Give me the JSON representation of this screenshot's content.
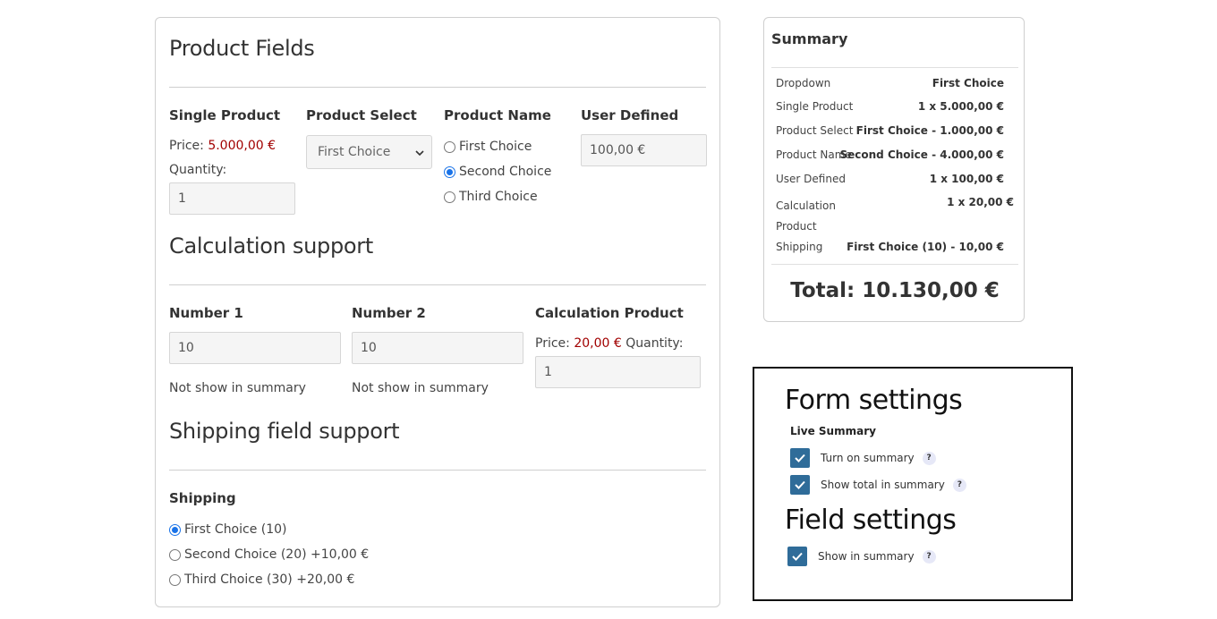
{
  "product_fields": {
    "title": "Product Fields",
    "single_product": {
      "label": "Single Product",
      "price_prefix": "Price:",
      "price": "5.000,00 €",
      "quantity_label": "Quantity:",
      "quantity_value": "1"
    },
    "product_select": {
      "label": "Product Select",
      "selected": "First Choice"
    },
    "product_name": {
      "label": "Product Name",
      "options": [
        "First Choice",
        "Second Choice",
        "Third Choice"
      ],
      "selected_index": 1
    },
    "user_defined": {
      "label": "User Defined",
      "value": "100,00 €"
    }
  },
  "calculation_support": {
    "title": "Calculation support",
    "number1": {
      "label": "Number 1",
      "value": "10",
      "note": "Not show in summary"
    },
    "number2": {
      "label": "Number 2",
      "value": "10",
      "note": "Not show in summary"
    },
    "calc_product": {
      "label": "Calculation Product",
      "price_prefix": "Price:",
      "price": "20,00 €",
      "quantity_label": "Quantity:",
      "quantity_value": "1"
    }
  },
  "shipping_support": {
    "title": "Shipping field support",
    "label": "Shipping",
    "options": [
      "First Choice (10)",
      "Second Choice (20) +10,00 €",
      "Third Choice (30) +20,00 €"
    ],
    "selected_index": 0
  },
  "summary": {
    "title": "Summary",
    "rows": [
      {
        "label": "Dropdown",
        "value": "First Choice"
      },
      {
        "label": "Single Product",
        "value": "1 x 5.000,00 €"
      },
      {
        "label": "Product Select",
        "value": "First Choice - 1.000,00 €"
      },
      {
        "label": "Product Name",
        "value": "Second Choice - 4.000,00 €"
      },
      {
        "label": "User Defined",
        "value": "1 x 100,00 €"
      },
      {
        "label": "Calculation\nProduct",
        "value": "1 x 20,00 €"
      },
      {
        "label": "Shipping",
        "value": "First Choice (10) - 10,00 €"
      }
    ],
    "total": "Total: 10.130,00 €"
  },
  "settings": {
    "form_title": "Form settings",
    "live_summary_label": "Live Summary",
    "turn_on_summary": "Turn on summary",
    "show_total": "Show total in summary",
    "field_title": "Field settings",
    "show_in_summary": "Show in summary",
    "help_glyph": "?",
    "checkbox_color": "#2f6c99"
  }
}
